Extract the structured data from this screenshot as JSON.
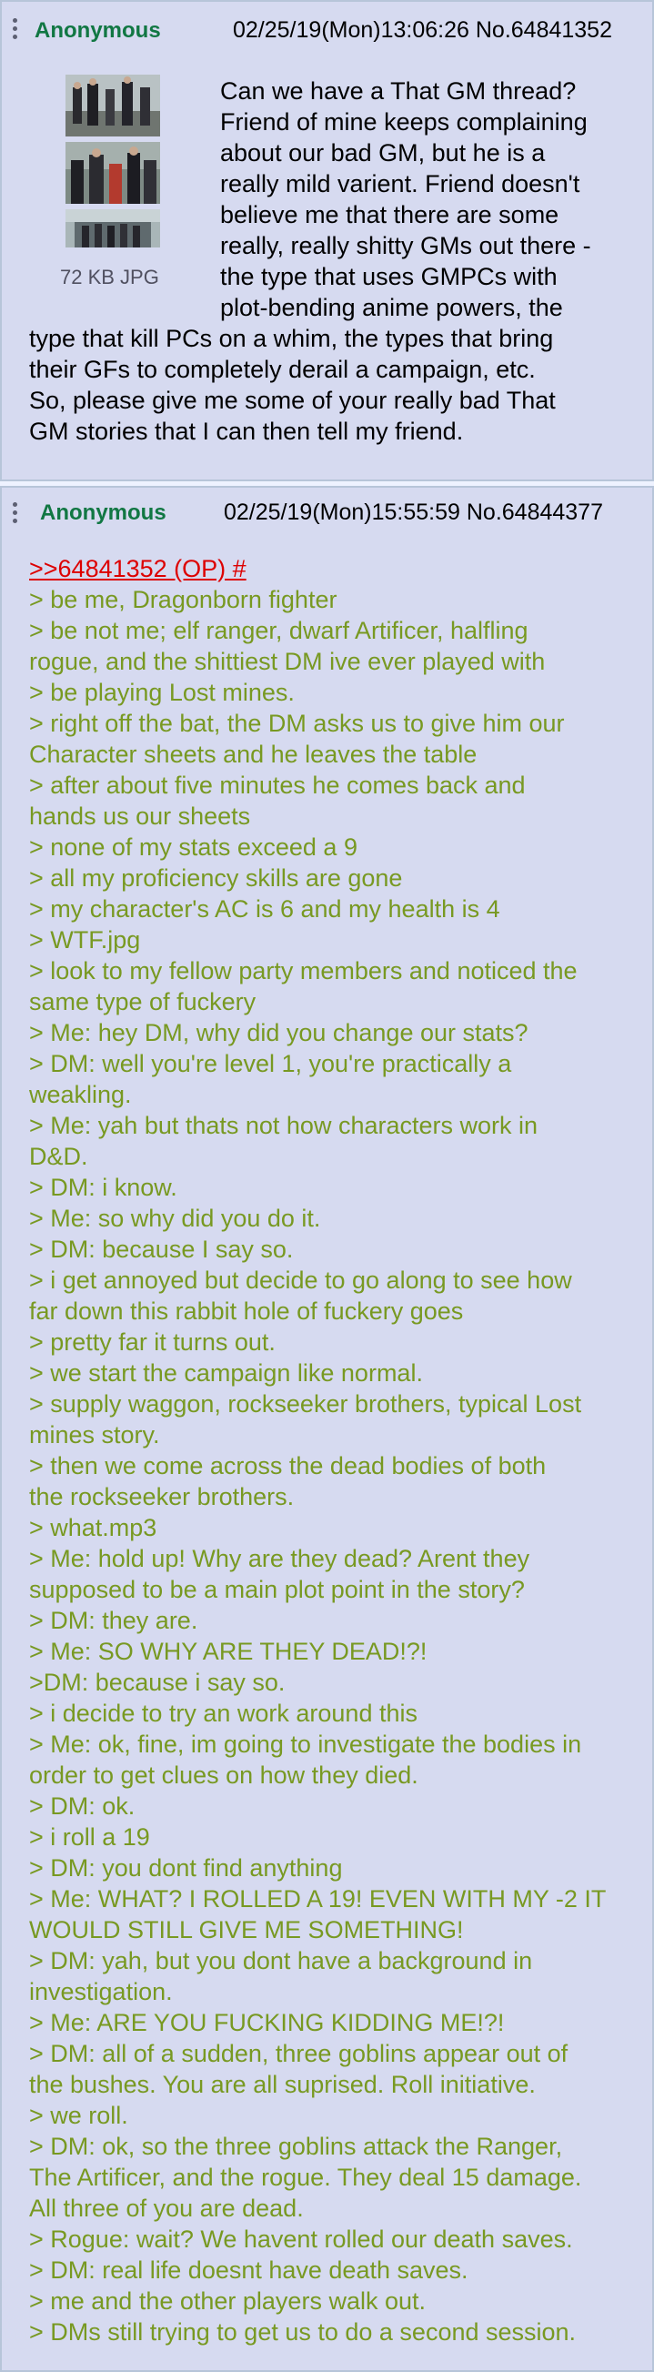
{
  "colors": {
    "post_bg": "#d6daf0",
    "post_border": "#b7c5d9",
    "name": "#117743",
    "greentext": "#789922",
    "quote_link": "#dd0000"
  },
  "post1": {
    "icon": "menu-dots-icon",
    "name": "Anonymous",
    "datetime_no": "02/25/19(Mon)13:06:26 No.64841352",
    "file_size": "72 KB JPG",
    "thumbnail_alt": "thumbnail image",
    "body_lines": [
      "Can we have a That GM thread?",
      "Friend of mine keeps complaining",
      "about our bad GM, but he is a",
      "really mild varient. Friend doesn't",
      "believe me that there are some",
      "really, really shitty GMs out there -",
      "the type that uses GMPCs with",
      "plot-bending anime powers, the",
      "type that kill PCs on a whim, the types that bring",
      "their GFs to completely derail a campaign, etc.",
      "So, please give me some of your really bad That",
      "GM stories that I can then tell my friend."
    ]
  },
  "post2": {
    "icon": "menu-dots-icon",
    "name": "Anonymous",
    "datetime_no": "02/25/19(Mon)15:55:59 No.64844377",
    "quote_link": ">>64841352 (OP) #",
    "greentext_lines": [
      "> be me, Dragonborn fighter",
      "> be not me; elf ranger, dwarf Artificer, halfling",
      "rogue, and the shittiest DM ive ever played with",
      "> be playing Lost mines.",
      "> right off the bat, the DM asks us to give him our",
      "Character sheets and he leaves the table",
      "> after about five minutes he comes back and",
      "hands us our sheets",
      "> none of my stats exceed a 9",
      "> all my proficiency skills are gone",
      "> my character's AC is 6 and my health is 4",
      "> WTF.jpg",
      "> look to my fellow party members and noticed the",
      "same type of fuckery",
      "> Me: hey DM, why did you change our stats?",
      "> DM: well you're level 1, you're practically a",
      "weakling.",
      "> Me: yah but thats not how characters work in",
      "D&D.",
      "> DM: i know.",
      "> Me: so why did you do it.",
      "> DM: because I say so.",
      "> i get annoyed but decide to go along to see how",
      "far down this rabbit hole of fuckery goes",
      "> pretty far it turns out.",
      "> we start the campaign like normal.",
      "> supply waggon, rockseeker brothers, typical Lost",
      "mines story.",
      "> then we come across the dead bodies of both",
      "the rockseeker brothers.",
      "> what.mp3",
      "> Me: hold up! Why are they dead? Arent they",
      "supposed to be a main plot point in the story?",
      "> DM: they are.",
      "> Me: SO WHY ARE THEY DEAD!?!",
      ">DM: because i say so.",
      "> i decide to try an work around this",
      "> Me: ok, fine, im going to investigate the bodies in",
      "order to get clues on how they died.",
      "> DM: ok.",
      "> i roll a 19",
      "> DM: you dont find anything",
      "> Me: WHAT? I ROLLED A 19! EVEN WITH MY -2 IT",
      "WOULD STILL GIVE ME SOMETHING!",
      "> DM: yah, but you dont have a background in",
      "investigation.",
      "> Me: ARE YOU FUCKING KIDDING ME!?!",
      "> DM: all of a sudden, three goblins appear out of",
      "the bushes. You are all suprised. Roll initiative.",
      "> we roll.",
      "> DM: ok, so the three goblins attack the Ranger,",
      "The Artificer, and the rogue. They deal 15 damage.",
      "All three of you are dead.",
      "> Rogue: wait? We havent rolled our death saves.",
      "> DM: real life doesnt have death saves.",
      "> me and the other players walk out.",
      "> DMs still trying to get us to do a second session."
    ]
  }
}
